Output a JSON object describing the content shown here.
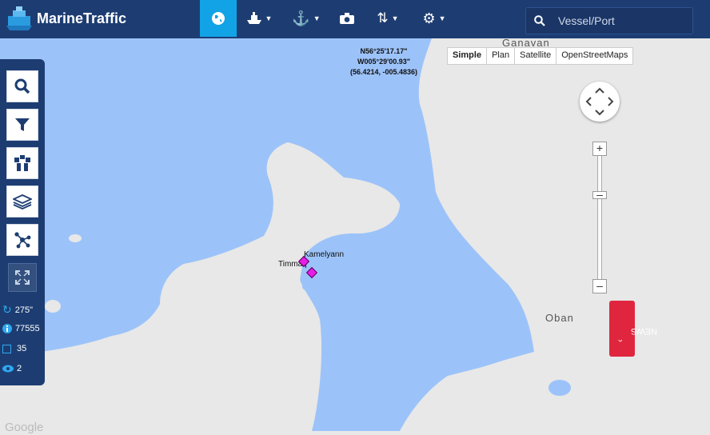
{
  "app": {
    "title": "MarineTraffic"
  },
  "nav": {
    "items": [
      {
        "name": "live-map",
        "icon": "globe-icon",
        "active": true
      },
      {
        "name": "vessels",
        "icon": "ship-icon"
      },
      {
        "name": "ports",
        "icon": "anchor-icon"
      },
      {
        "name": "photos",
        "icon": "camera-icon"
      },
      {
        "name": "services",
        "icon": "sync-icon"
      },
      {
        "name": "settings",
        "icon": "gear-icon"
      }
    ],
    "search_placeholder": "Vessel/Port"
  },
  "map": {
    "coord_lines": [
      "N56°25'17.17\"",
      "W005°29'00.93\"",
      "(56.4214, -005.4836)"
    ],
    "map_types": [
      "Simple",
      "Plan",
      "Satellite",
      "OpenStreetMaps"
    ],
    "selected_map_type": "Simple",
    "ships": [
      {
        "name": "Kamelyann"
      },
      {
        "name": "Timmaq"
      }
    ],
    "places": [
      "Oban",
      "Ganavan"
    ],
    "attribution": "Google",
    "news_label": "NEWS"
  },
  "sidebar": {
    "tools": [
      "search-icon",
      "filter-icon",
      "fleet-icon",
      "layers-icon",
      "network-icon",
      "fullscreen-icon"
    ],
    "stats": [
      {
        "icon": "refresh-icon",
        "value": "275\""
      },
      {
        "icon": "info-icon",
        "value": "77555"
      },
      {
        "icon": "square-icon",
        "value": "35"
      },
      {
        "icon": "eye-icon",
        "value": "2"
      }
    ]
  },
  "colors": {
    "navbar": "#1d3d72",
    "active_tab": "#12a2e6",
    "sea": "#9cc3f9",
    "land": "#e8e8e8",
    "news": "#e0263f",
    "marker": "#e81ee8"
  }
}
